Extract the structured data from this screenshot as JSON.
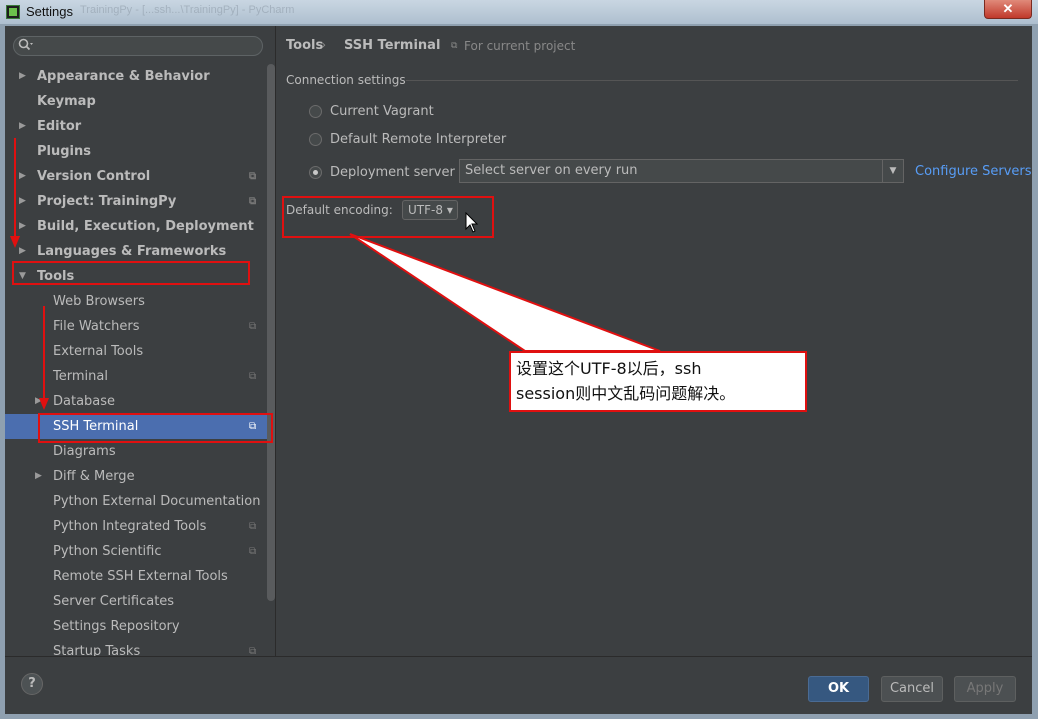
{
  "window": {
    "title": "Settings",
    "title_ghost": "TrainingPy - [...ssh...\\TrainingPy] - PyCharm",
    "close_glyph": "✕"
  },
  "search": {
    "placeholder": "",
    "icon": "search-icon"
  },
  "sidebar": {
    "items": [
      {
        "label": "Appearance & Behavior",
        "arrow": "▶",
        "bold": true,
        "project": false
      },
      {
        "label": "Keymap",
        "arrow": "",
        "bold": true,
        "project": false
      },
      {
        "label": "Editor",
        "arrow": "▶",
        "bold": true,
        "project": false
      },
      {
        "label": "Plugins",
        "arrow": "",
        "bold": true,
        "project": false
      },
      {
        "label": "Version Control",
        "arrow": "▶",
        "bold": true,
        "project": true
      },
      {
        "label": "Project: TrainingPy",
        "arrow": "▶",
        "bold": true,
        "project": true
      },
      {
        "label": "Build, Execution, Deployment",
        "arrow": "▶",
        "bold": true,
        "project": false
      },
      {
        "label": "Languages & Frameworks",
        "arrow": "▶",
        "bold": true,
        "project": false
      },
      {
        "label": "Tools",
        "arrow": "▼",
        "bold": true,
        "project": false
      },
      {
        "label": "Web Browsers",
        "arrow": "",
        "bold": false,
        "project": false
      },
      {
        "label": "File Watchers",
        "arrow": "",
        "bold": false,
        "project": true
      },
      {
        "label": "External Tools",
        "arrow": "",
        "bold": false,
        "project": false
      },
      {
        "label": "Terminal",
        "arrow": "",
        "bold": false,
        "project": true
      },
      {
        "label": "Database",
        "arrow": "▶",
        "bold": false,
        "project": false
      },
      {
        "label": "SSH Terminal",
        "arrow": "",
        "bold": false,
        "project": true
      },
      {
        "label": "Diagrams",
        "arrow": "",
        "bold": false,
        "project": false
      },
      {
        "label": "Diff & Merge",
        "arrow": "▶",
        "bold": false,
        "project": false
      },
      {
        "label": "Python External Documentation",
        "arrow": "",
        "bold": false,
        "project": false
      },
      {
        "label": "Python Integrated Tools",
        "arrow": "",
        "bold": false,
        "project": true
      },
      {
        "label": "Python Scientific",
        "arrow": "",
        "bold": false,
        "project": true
      },
      {
        "label": "Remote SSH External Tools",
        "arrow": "",
        "bold": false,
        "project": false
      },
      {
        "label": "Server Certificates",
        "arrow": "",
        "bold": false,
        "project": false
      },
      {
        "label": "Settings Repository",
        "arrow": "",
        "bold": false,
        "project": false
      },
      {
        "label": "Startup Tasks",
        "arrow": "",
        "bold": false,
        "project": true
      }
    ],
    "selected": "SSH Terminal",
    "project_glyph": "⧉"
  },
  "breadcrumb": {
    "parent": "Tools",
    "separator": "›",
    "current": "SSH Terminal",
    "note_icon": "⧉",
    "note": "For current project"
  },
  "connection": {
    "section_title": "Connection settings",
    "options": [
      {
        "label": "Current Vagrant",
        "selected": false
      },
      {
        "label": "Default Remote Interpreter",
        "selected": false
      },
      {
        "label": "Deployment server",
        "selected": true
      }
    ],
    "server_value": "Select server on every run",
    "server_drop_glyph": "▼",
    "configure_link": "Configure Servers"
  },
  "encoding": {
    "label": "Default encoding:",
    "value": "UTF-8",
    "drop_glyph": "▾"
  },
  "callout": {
    "line1": "设置这个UTF-8以后，ssh",
    "line2": "session则中文乱码问题解决。"
  },
  "footer": {
    "help": "?",
    "ok": "OK",
    "cancel": "Cancel",
    "apply": "Apply"
  },
  "colors": {
    "annotation_red": "#e01010",
    "selection": "#4b6eaf",
    "link": "#589df6",
    "panel_bg": "#3c3f41"
  }
}
